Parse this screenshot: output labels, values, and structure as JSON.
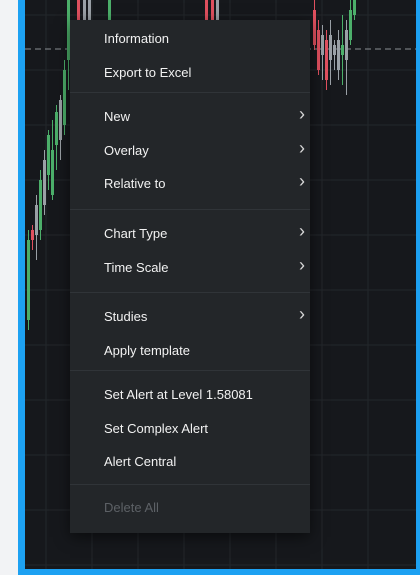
{
  "menu": {
    "groups": [
      [
        {
          "label": "Information",
          "submenu": false,
          "enabled": true
        },
        {
          "label": "Export to Excel",
          "submenu": false,
          "enabled": true
        }
      ],
      [
        {
          "label": "New",
          "submenu": true,
          "enabled": true
        },
        {
          "label": "Overlay",
          "submenu": true,
          "enabled": true
        },
        {
          "label": "Relative to",
          "submenu": true,
          "enabled": true
        }
      ],
      [
        {
          "label": "Chart Type",
          "submenu": true,
          "enabled": true
        },
        {
          "label": "Time Scale",
          "submenu": true,
          "enabled": true
        }
      ],
      [
        {
          "label": "Studies",
          "submenu": true,
          "enabled": true
        },
        {
          "label": "Apply template",
          "submenu": false,
          "enabled": true
        }
      ],
      [
        {
          "label": "Set Alert at Level 1.58081",
          "submenu": false,
          "enabled": true
        },
        {
          "label": "Set Complex Alert",
          "submenu": false,
          "enabled": true
        },
        {
          "label": "Alert Central",
          "submenu": false,
          "enabled": true
        }
      ],
      [
        {
          "label": "Delete All",
          "submenu": false,
          "enabled": false
        }
      ]
    ],
    "submenu_icon": "chevron-right-icon"
  },
  "colors": {
    "border": "#1da1f2",
    "chart_bg": "#16181c",
    "menu_bg": "#232629",
    "bull_candle": "#4caf6a",
    "bear_candle": "#e0505f",
    "neutral_candle": "#9aa0a6"
  }
}
